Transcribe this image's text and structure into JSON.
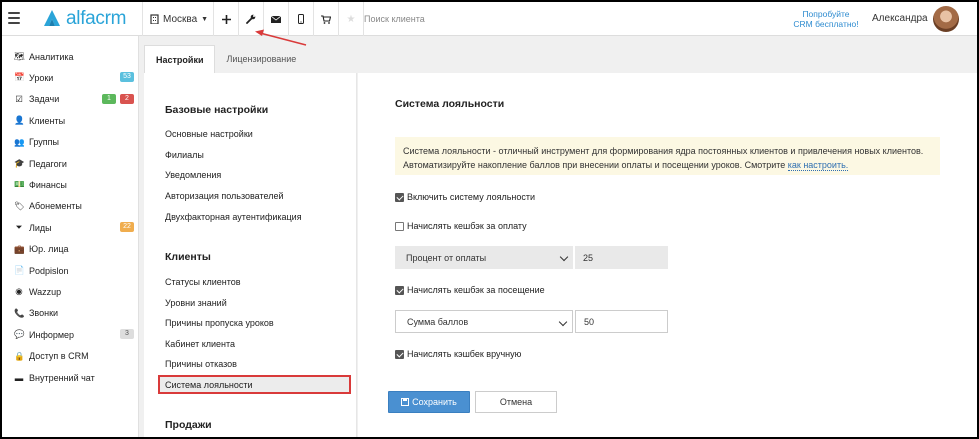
{
  "app": {
    "logo_text": "alfacrm"
  },
  "header": {
    "city": "Москва",
    "search_placeholder": "Поиск клиента",
    "trial_line1": "Попробуйте",
    "trial_line2": "CRM бесплатно!",
    "user_name": "Александра",
    "icons": [
      "menu-icon",
      "building-icon",
      "plus-icon",
      "wrench-icon",
      "mail-icon",
      "phone-icon",
      "cart-icon",
      "star-icon"
    ],
    "arrow_color": "#d93a3a"
  },
  "sidebar": {
    "items": [
      {
        "label": "Аналитика",
        "icon": "map-icon",
        "glyph": "🗺"
      },
      {
        "label": "Уроки",
        "icon": "calendar-icon",
        "glyph": "📅",
        "badges": [
          {
            "text": "53",
            "color": "teal"
          }
        ]
      },
      {
        "label": "Задачи",
        "icon": "tasks-icon",
        "glyph": "☑",
        "badges": [
          {
            "text": "1",
            "color": "green"
          },
          {
            "text": "2",
            "color": "red"
          }
        ]
      },
      {
        "label": "Клиенты",
        "icon": "user-icon",
        "glyph": "👤"
      },
      {
        "label": "Группы",
        "icon": "users-icon",
        "glyph": "👥"
      },
      {
        "label": "Педагоги",
        "icon": "graduation-cap-icon",
        "glyph": "🎓"
      },
      {
        "label": "Финансы",
        "icon": "money-icon",
        "glyph": "💵"
      },
      {
        "label": "Абонементы",
        "icon": "tag-icon",
        "glyph": "🏷"
      },
      {
        "label": "Лиды",
        "icon": "funnel-icon",
        "glyph": "⏷",
        "badges": [
          {
            "text": "22",
            "color": "orange"
          }
        ]
      },
      {
        "label": "Юр. лица",
        "icon": "briefcase-icon",
        "glyph": "💼"
      },
      {
        "label": "Podpislon",
        "icon": "document-icon",
        "glyph": "📄"
      },
      {
        "label": "Wazzup",
        "icon": "whatsapp-icon",
        "glyph": "◉"
      },
      {
        "label": "Звонки",
        "icon": "phone-icon",
        "glyph": "📞"
      },
      {
        "label": "Информер",
        "icon": "chat-icon",
        "glyph": "💬",
        "badges": [
          {
            "text": "3",
            "color": "grey"
          }
        ]
      },
      {
        "label": "Доступ в CRM",
        "icon": "lock-icon",
        "glyph": "🔒"
      },
      {
        "label": "Внутренний чат",
        "icon": "message-icon",
        "glyph": "▬"
      }
    ]
  },
  "tabs": [
    {
      "label": "Настройки",
      "active": true
    },
    {
      "label": "Лицензирование",
      "active": false
    }
  ],
  "settings_menu": {
    "basic_heading": "Базовые настройки",
    "basic_items": [
      "Основные настройки",
      "Филиалы",
      "Уведомления",
      "Авторизация пользователей",
      "Двухфакторная аутентификация"
    ],
    "clients_heading": "Клиенты",
    "client_items": [
      "Статусы клиентов",
      "Уровни знаний",
      "Причины пропуска уроков",
      "Кабинет клиента",
      "Причины отказов",
      "Система лояльности"
    ],
    "active_item": "Система лояльности",
    "sales_heading": "Продажи"
  },
  "content": {
    "title": "Система лояльности",
    "info_text": "Система лояльности - отличный инструмент для формирования ядра постоянных клиентов и привлечения новых клиентов. Автоматизируйте накопление баллов при внесении оплаты и посещении уроков. Смотрите ",
    "info_link": "как настроить.",
    "enable_label": "Включить систему лояльности",
    "enable_checked": true,
    "cashback_payment_label": "Начислять кешбэк за оплату",
    "cashback_payment_checked": false,
    "payment_mode": "Процент от оплаты",
    "payment_value": "25",
    "cashback_visit_label": "Начислять кешбэк за посещение",
    "cashback_visit_checked": true,
    "visit_mode": "Сумма баллов",
    "visit_value": "50",
    "manual_label": "Начислять кэшбек вручную",
    "manual_checked": true,
    "save_label": "Сохранить",
    "cancel_label": "Отмена"
  }
}
